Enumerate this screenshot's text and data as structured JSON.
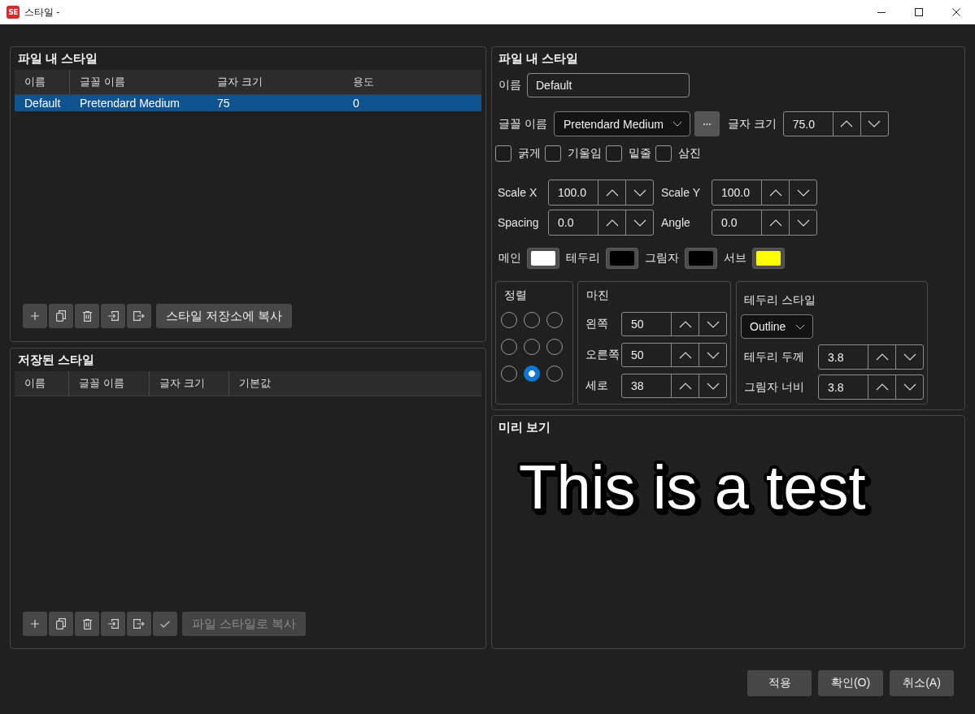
{
  "window": {
    "logo": "SE",
    "title": "스타일 -"
  },
  "file_styles": {
    "title": "파일 내 스타일",
    "columns": [
      "이름",
      "글꼴 이름",
      "글자 크기",
      "용도"
    ],
    "rows": [
      {
        "cells": [
          "Default",
          "Pretendard Medium",
          "75",
          "0"
        ],
        "selected": true
      }
    ],
    "copy_button": {
      "label": "스타일 저장소에 복사",
      "disabled": false
    }
  },
  "saved_styles": {
    "title": "저장된 스타일",
    "columns": [
      "이름",
      "글꼴 이름",
      "글자 크기",
      "기본값"
    ],
    "copy_button": {
      "label": "파일 스타일로 복사",
      "disabled": true
    }
  },
  "editor": {
    "title": "파일 내 스타일",
    "name": {
      "label": "이름",
      "value": "Default"
    },
    "font": {
      "label": "글꼴 이름",
      "value": "Pretendard Medium"
    },
    "size": {
      "label": "글자 크기",
      "value": "75.0"
    },
    "effects": [
      {
        "label": "굵게",
        "checked": false
      },
      {
        "label": "기울임",
        "checked": false
      },
      {
        "label": "밑줄",
        "checked": false
      },
      {
        "label": "삼진",
        "checked": false
      }
    ],
    "transforms": [
      {
        "label": "Scale X",
        "value": "100.0"
      },
      {
        "label": "Scale Y",
        "value": "100.0"
      },
      {
        "label": "Spacing",
        "value": "0.0"
      },
      {
        "label": "Angle",
        "value": "0.0"
      }
    ],
    "colors": [
      {
        "label": "메인",
        "color": "#ffffff"
      },
      {
        "label": "테두리",
        "color": "#000000"
      },
      {
        "label": "그림자",
        "color": "#000000"
      },
      {
        "label": "서브",
        "color": "#ffff00"
      }
    ],
    "alignment": {
      "title": "정렬",
      "options": [
        {
          "selected": false
        },
        {
          "selected": false
        },
        {
          "selected": false
        },
        {
          "selected": false
        },
        {
          "selected": false
        },
        {
          "selected": false
        },
        {
          "selected": false
        },
        {
          "selected": true
        },
        {
          "selected": false
        }
      ]
    },
    "margin": {
      "title": "마진",
      "fields": [
        {
          "label": "왼쪽",
          "value": "50"
        },
        {
          "label": "오른쪽",
          "value": "50"
        },
        {
          "label": "세로",
          "value": "38"
        }
      ]
    },
    "border_style": {
      "title": "테두리 스타일",
      "type": "Outline",
      "fields": [
        {
          "label": "테두리 두께",
          "value": "3.8"
        },
        {
          "label": "그림자 너비",
          "value": "3.8"
        }
      ]
    }
  },
  "preview": {
    "title": "미리 보기",
    "text": "This is a test"
  },
  "buttons": [
    "적용",
    "확인(O)",
    "취소(A)"
  ]
}
